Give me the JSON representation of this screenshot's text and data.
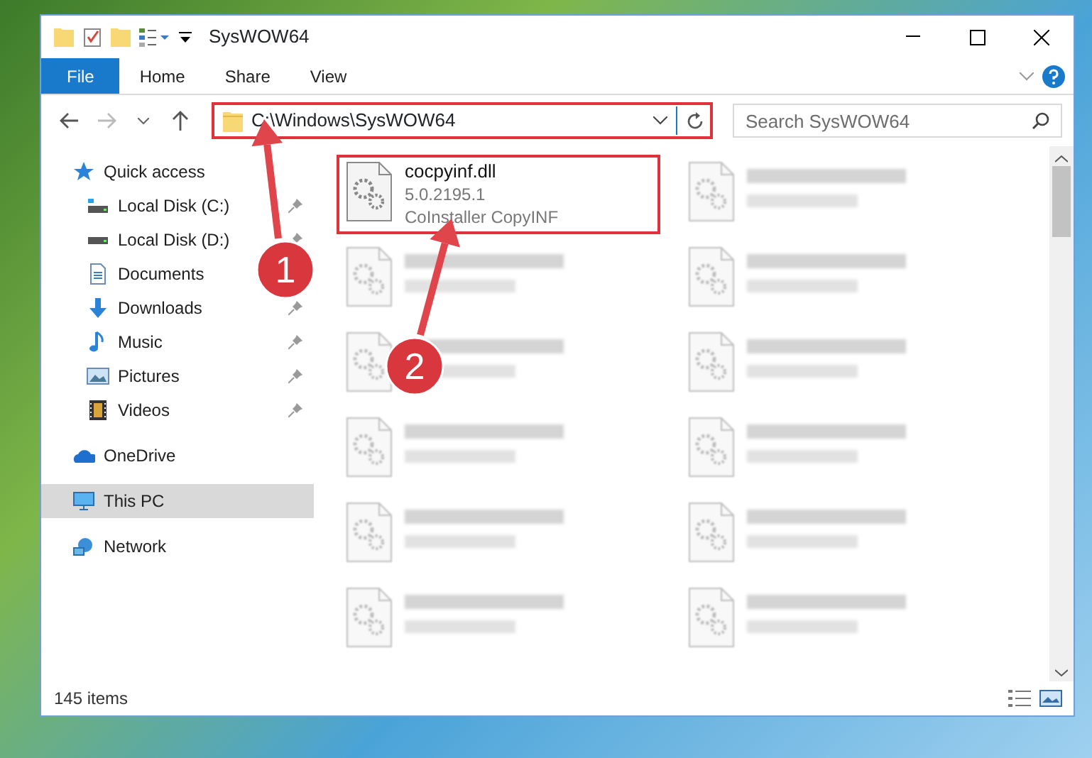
{
  "window": {
    "title": "SysWOW64"
  },
  "ribbon_tabs": [
    {
      "label": "File",
      "kind": "file_menu"
    },
    {
      "label": "Home",
      "kind": "tab"
    },
    {
      "label": "Share",
      "kind": "tab"
    },
    {
      "label": "View",
      "kind": "tab"
    }
  ],
  "address_bar": {
    "path": "C:\\Windows\\SysWOW64",
    "highlighted": true
  },
  "search": {
    "placeholder": "Search SysWOW64"
  },
  "sidebar": {
    "items": [
      {
        "label": "Quick access",
        "kind": "star",
        "selected": false,
        "children": [
          {
            "label": "Local Disk (C:)",
            "kind": "system_drive",
            "pinned": true,
            "selected": false
          },
          {
            "label": "Local Disk (D:)",
            "kind": "drive",
            "pinned": true,
            "selected": false
          },
          {
            "label": "Documents",
            "kind": "documents",
            "pinned": false,
            "selected": false
          },
          {
            "label": "Downloads",
            "kind": "downloads",
            "pinned": true,
            "selected": false
          },
          {
            "label": "Music",
            "kind": "music",
            "pinned": true,
            "selected": false
          },
          {
            "label": "Pictures",
            "kind": "pictures",
            "pinned": true,
            "selected": false
          },
          {
            "label": "Videos",
            "kind": "videos",
            "pinned": true,
            "selected": false
          }
        ]
      },
      {
        "label": "OneDrive",
        "kind": "cloud",
        "selected": false
      },
      {
        "label": "This PC",
        "kind": "pc",
        "selected": true
      },
      {
        "label": "Network",
        "kind": "network",
        "selected": false
      }
    ]
  },
  "files": [
    {
      "lines": [
        "cocpyinf.dll",
        "5.0.2195.1",
        "CoInstaller CopyINF"
      ],
      "highlighted": true,
      "blurred": false
    },
    {
      "highlighted": false,
      "blurred": true
    },
    {
      "highlighted": false,
      "blurred": true
    },
    {
      "highlighted": false,
      "blurred": true
    },
    {
      "highlighted": false,
      "blurred": true
    },
    {
      "highlighted": false,
      "blurred": true
    },
    {
      "highlighted": false,
      "blurred": true
    },
    {
      "highlighted": false,
      "blurred": true
    },
    {
      "highlighted": false,
      "blurred": true
    },
    {
      "highlighted": false,
      "blurred": true
    },
    {
      "highlighted": false,
      "blurred": true
    },
    {
      "highlighted": false,
      "blurred": true
    }
  ],
  "status_bar": {
    "item_count": "145 items"
  },
  "callouts": [
    {
      "number": "1"
    },
    {
      "number": "2"
    }
  ]
}
